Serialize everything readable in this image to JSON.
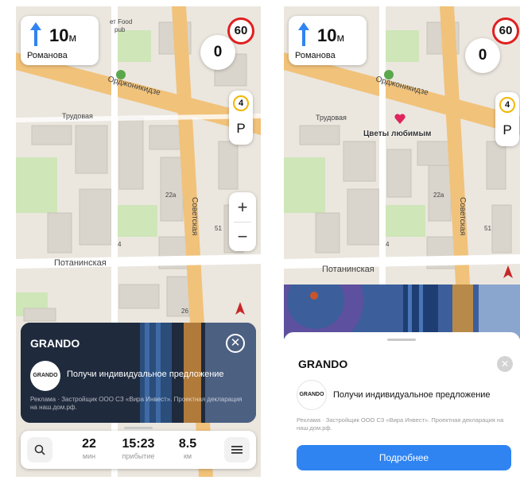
{
  "left_screen": {
    "maneuver": {
      "distance": "10",
      "unit": "м",
      "street": "Романова"
    },
    "speed_limit": "60",
    "current_speed": "0",
    "lane_badge": "4",
    "parking_label": "P",
    "zoom": {
      "plus": "+",
      "minus": "−"
    },
    "map_labels": {
      "ordzhonikidze": "Орджоникидзе",
      "trudovaya": "Трудовая",
      "sovetskaya": "Советская",
      "potaninskaya": "Потанинская",
      "poi_top": "ет Food",
      "poi_top2": "pub",
      "house_22a": "22а",
      "house_51": "51",
      "house_4": "4",
      "house_26": "26"
    },
    "ad": {
      "brand": "GRANDO",
      "logo": "GRANDO",
      "offer": "Получи индивидуальное предложение",
      "disclaimer": "Реклама · Застройщик ООО СЗ «Вира Инвест». Проектная декларация на наш.дом.рф."
    },
    "route": {
      "time_value": "22",
      "time_label": "мин",
      "arrival_value": "15:23",
      "arrival_label": "прибытие",
      "distance_value": "8.5",
      "distance_label": "км"
    },
    "icons": {
      "search": "search-icon",
      "menu": "menu-icon",
      "close": "close-icon"
    }
  },
  "right_screen": {
    "maneuver": {
      "distance": "10",
      "unit": "м",
      "street": "Романова"
    },
    "speed_limit": "60",
    "current_speed": "0",
    "lane_badge": "4",
    "parking_label": "P",
    "pin_label": "Цветы любимым",
    "map_labels": {
      "ordzhonikidze": "Орджоникидзе",
      "trudovaya": "Трудовая",
      "sovetskaya": "Советская",
      "potaninskaya": "Потанинская",
      "house_22a": "22а",
      "house_51": "51",
      "house_4": "4"
    },
    "ad": {
      "brand": "GRANDO",
      "logo": "GRANDO",
      "offer": "Получи индивидуальное предложение",
      "disclaimer": "Реклама · Застройщик ООО СЗ «Вира Инвест». Проектная декларация на наш.дом.рф.",
      "cta": "Подробнее"
    }
  },
  "colors": {
    "accent_blue": "#2f84f2",
    "speed_limit_red": "#e02020",
    "road_orange": "#f1c27a",
    "map_bg": "#ebe7df",
    "park_green": "#cfe6b8"
  }
}
